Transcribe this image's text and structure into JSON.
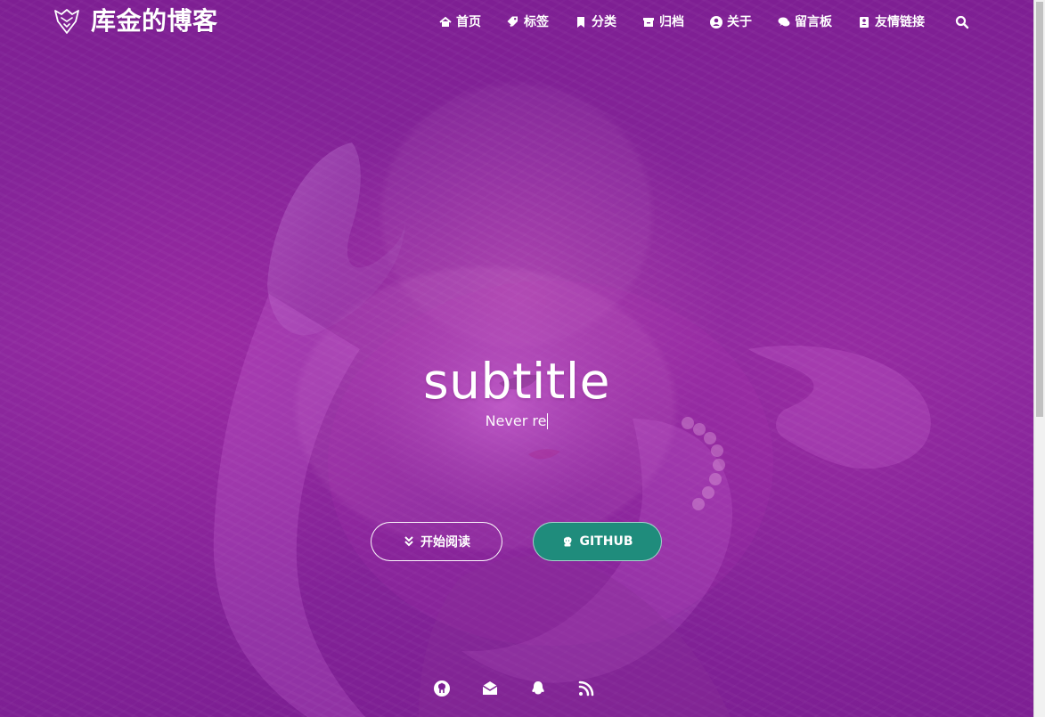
{
  "brand": {
    "title": "库金的博客",
    "icon": "fox-logo-icon"
  },
  "nav": [
    {
      "label": "首页",
      "icon": "home-icon"
    },
    {
      "label": "标签",
      "icon": "tags-icon"
    },
    {
      "label": "分类",
      "icon": "bookmark-icon"
    },
    {
      "label": "归档",
      "icon": "archive-icon"
    },
    {
      "label": "关于",
      "icon": "user-circle-icon"
    },
    {
      "label": "留言板",
      "icon": "comments-icon"
    },
    {
      "label": "友情链接",
      "icon": "address-card-icon"
    },
    {
      "label": "",
      "icon": "search-icon"
    }
  ],
  "hero": {
    "title": "subtitle",
    "subtitle": "Never re",
    "buttons": {
      "read": "开始阅读",
      "github": "GITHUB"
    }
  },
  "social": [
    {
      "icon": "github-icon"
    },
    {
      "icon": "mail-icon"
    },
    {
      "icon": "qq-icon"
    },
    {
      "icon": "rss-icon"
    }
  ],
  "colors": {
    "hero": "#7b1f93",
    "github_button": "#1f8c7c",
    "text": "#ffffff"
  }
}
